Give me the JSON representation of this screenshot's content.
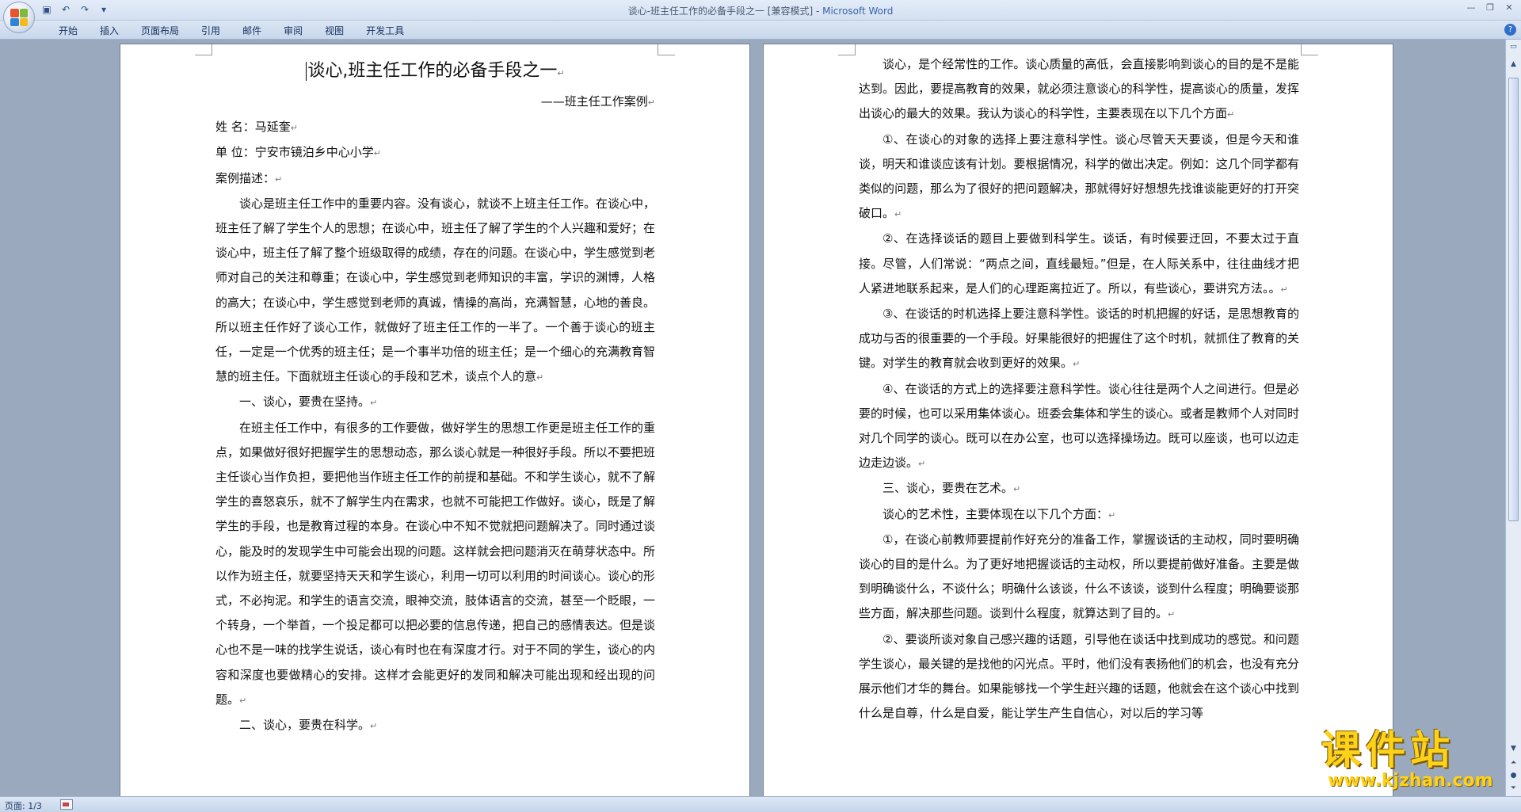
{
  "window": {
    "title": "谈心-班主任工作的必备手段之一 [兼容模式] - ",
    "app_name": "Microsoft Word",
    "controls": [
      "minimize-icon",
      "restore-icon",
      "close-icon"
    ]
  },
  "quick_access": [
    "save-icon",
    "undo-icon",
    "redo-icon",
    "customize-icon"
  ],
  "ribbon": {
    "tabs": [
      "开始",
      "插入",
      "页面布局",
      "引用",
      "邮件",
      "审阅",
      "视图",
      "开发工具"
    ]
  },
  "status": {
    "page": "页面: 1/3"
  },
  "colors": {
    "accent": "#3a63a8",
    "watermark": "#ffd21a"
  },
  "document": {
    "left_page": {
      "title": "谈心,班主任工作的必备手段之一",
      "subtitle": "——班主任工作案例",
      "meta": [
        "姓    名：马延奎",
        "单    位：宁安市镜泊乡中心小学",
        "案例描述："
      ],
      "paragraphs": [
        "谈心是班主任工作中的重要内容。没有谈心，就谈不上班主任工作。在谈心中，班主任了解了学生个人的思想；在谈心中，班主任了解了学生的个人兴趣和爱好；在谈心中，班主任了解了整个班级取得的成绩，存在的问题。在谈心中，学生感觉到老师对自己的关注和尊重；在谈心中，学生感觉到老师知识的丰富，学识的渊博，人格的高大；在谈心中，学生感觉到老师的真诚，情操的高尚，充满智慧，心地的善良。所以班主任作好了谈心工作，就做好了班主任工作的一半了。一个善于谈心的班主任，一定是一个优秀的班主任；是一个事半功倍的班主任；是一个细心的充满教育智慧的班主任。下面就班主任谈心的手段和艺术，谈点个人的意",
        "一、谈心，要贵在坚持。",
        "在班主任工作中，有很多的工作要做，做好学生的思想工作更是班主任工作的重点，如果做好很好把握学生的思想动态，那么谈心就是一种很好手段。所以不要把班主任谈心当作负担，要把他当作班主任工作的前提和基础。不和学生谈心，就不了解学生的喜怒哀乐，就不了解学生内在需求，也就不可能把工作做好。谈心，既是了解学生的手段，也是教育过程的本身。在谈心中不知不觉就把问题解决了。同时通过谈心，能及时的发现学生中可能会出现的问题。这样就会把问题消灭在萌芽状态中。所以作为班主任，就要坚持天天和学生谈心，利用一切可以利用的时间谈心。谈心的形式，不必拘泥。和学生的语言交流，眼神交流，肢体语言的交流，甚至一个眨眼，一个转身，一个举首，一个投足都可以把必要的信息传递，把自己的感情表达。但是谈心也不是一味的找学生说话，谈心有时也在有深度才行。对于不同的学生，谈心的内容和深度也要做精心的安排。这样才会能更好的发同和解决可能出现和经出现的问题。",
        "二、谈心，要贵在科学。"
      ]
    },
    "right_page": {
      "paragraphs": [
        "谈心，是个经常性的工作。谈心质量的高低，会直接影响到谈心的目的是不是能达到。因此，要提高教育的效果，就必须注意谈心的科学性，提高谈心的质量，发挥出谈心的最大的效果。我认为谈心的科学性，主要表现在以下几个方面",
        "①、在谈心的对象的选择上要注意科学性。谈心尽管天天要谈，但是今天和谁谈，明天和谁谈应该有计划。要根据情况，科学的做出决定。例如：这几个同学都有类似的问题，那么为了很好的把问题解决，那就得好好想想先找谁谈能更好的打开突破口。",
        "②、在选择谈话的题目上要做到科学生。谈话，有时候要迂回，不要太过于直接。尽管，人们常说：“两点之间，直线最短。”但是，在人际关系中，往往曲线才把人紧进地联系起来，是人们的心理距离拉近了。所以，有些谈心，要讲究方法。。",
        "③、在谈话的时机选择上要注意科学性。谈话的时机把握的好话，是思想教育的成功与否的很重要的一个手段。好果能很好的把握住了这个时机，就抓住了教育的关键。对学生的教育就会收到更好的效果。",
        "④、在谈话的方式上的选择要注意科学性。谈心往往是两个人之间进行。但是必要的时候，也可以采用集体谈心。班委会集体和学生的谈心。或者是教师个人对同时对几个同学的谈心。既可以在办公室，也可以选择操场边。既可以座谈，也可以边走边走边谈。",
        "三、谈心，要贵在艺术。",
        "谈心的艺术性，主要体现在以下几个方面：",
        "①，在谈心前教师要提前作好充分的准备工作，掌握谈话的主动权，同时要明确谈心的目的是什么。为了更好地把握谈话的主动权，所以要提前做好准备。主要是做到明确谈什么，不谈什么；明确什么该谈，什么不该谈，谈到什么程度；明确要谈那些方面，解决那些问题。谈到什么程度，就算达到了目的。",
        "②、要谈所谈对象自己感兴趣的话题，引导他在谈话中找到成功的感觉。和问题学生谈心，最关键的是找他的闪光点。平时，他们没有表扬他们的机会，也没有充分展示他们才华的舞台。如果能够找一个学生赶兴趣的话题，他就会在这个谈心中找到什么是自尊，什么是自爱，能让学生产生自信心，对以后的学习等"
      ]
    }
  },
  "watermark": {
    "title": "课件站",
    "url": "www.kjzhan.com"
  }
}
